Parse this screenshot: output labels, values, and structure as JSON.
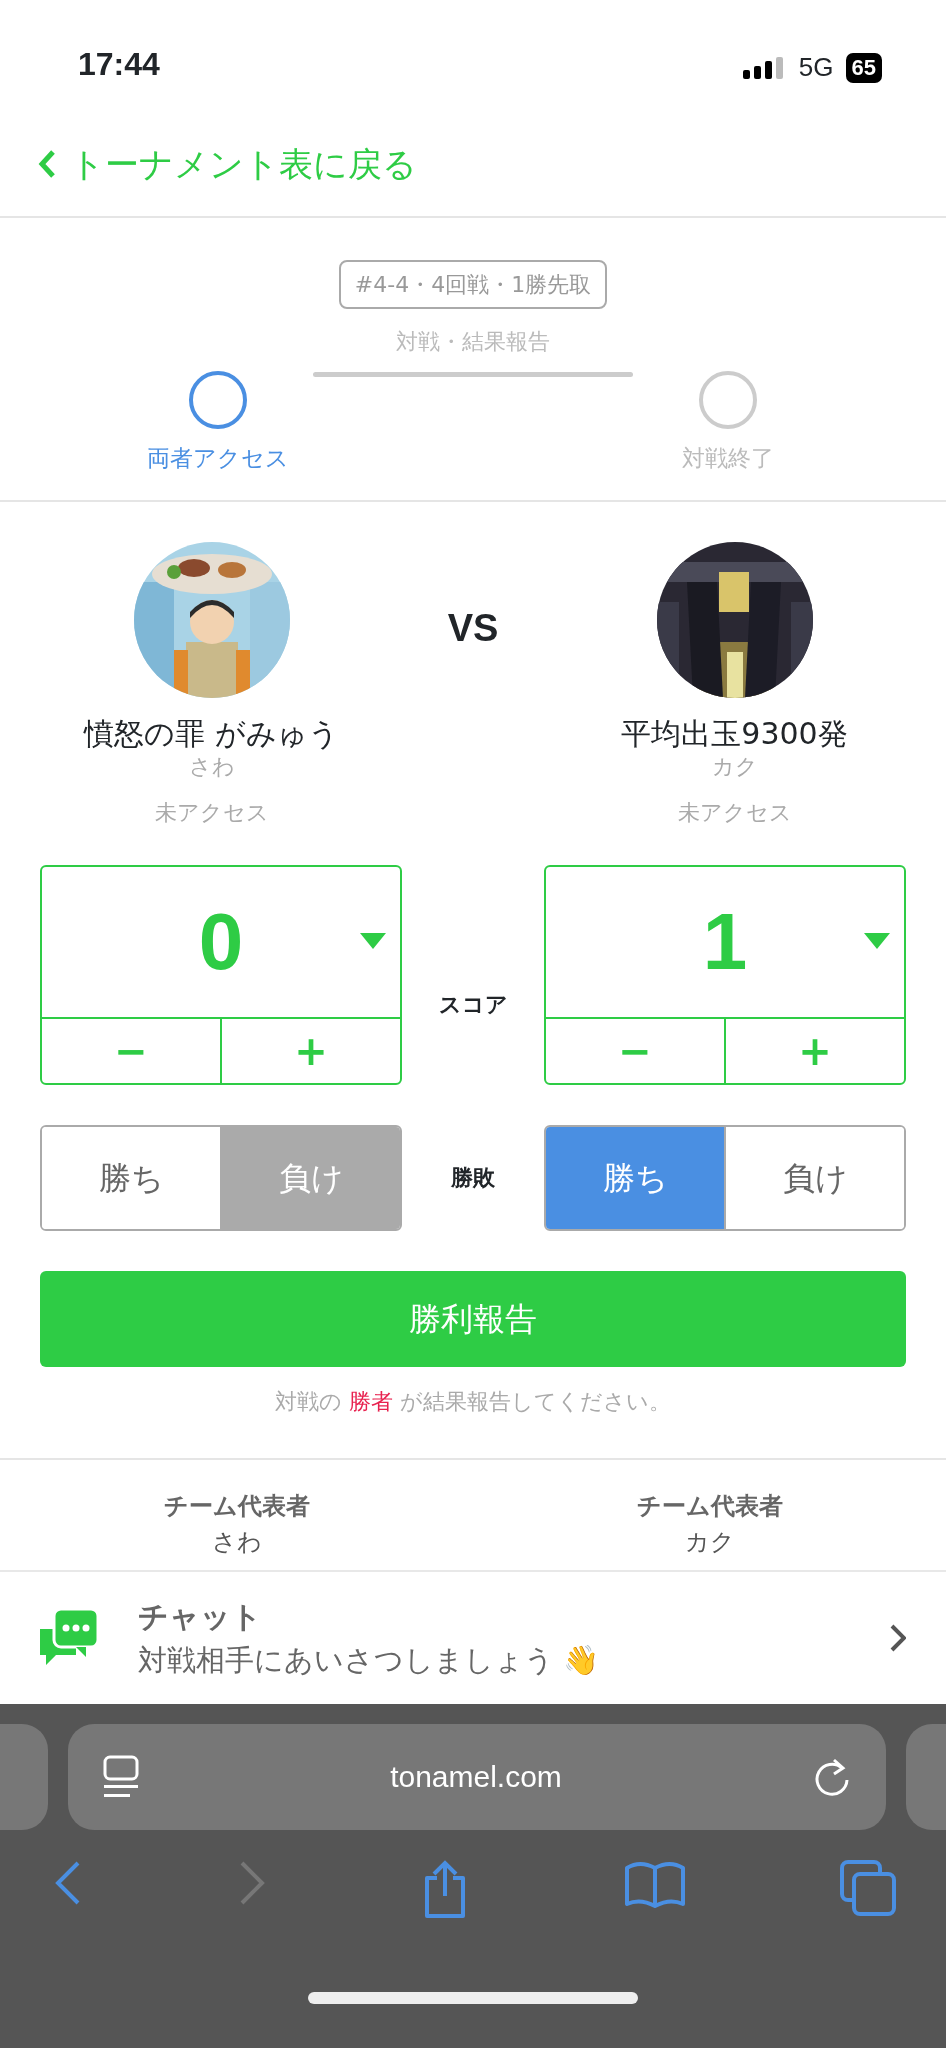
{
  "status_bar": {
    "time": "17:44",
    "network": "5G",
    "battery": "65"
  },
  "back_link": {
    "label": "トーナメント表に戻る"
  },
  "match_badge": "#4-4・4回戦・1勝先取",
  "progress": {
    "connector_label": "対戦・結果報告",
    "steps": [
      {
        "label": "両者アクセス",
        "selected": true
      },
      {
        "label": "対戦終了",
        "selected": false
      }
    ]
  },
  "versus_label": "VS",
  "players": [
    {
      "name": "憤怒の罪 がみゅう",
      "sub_name": "さわ",
      "access": "未アクセス",
      "score": "0",
      "decrement": "−",
      "increment": "+",
      "result_options": [
        {
          "kind": "win",
          "label": "勝ち",
          "selected": false
        },
        {
          "kind": "lose",
          "label": "負け",
          "selected": true
        }
      ]
    },
    {
      "name": "平均出玉9300発",
      "sub_name": "カク",
      "access": "未アクセス",
      "score": "1",
      "decrement": "−",
      "increment": "+",
      "result_options": [
        {
          "kind": "win",
          "label": "勝ち",
          "selected": true
        },
        {
          "kind": "lose",
          "label": "負け",
          "selected": false
        }
      ]
    }
  ],
  "score_label": "スコア",
  "result_label": "勝敗",
  "report_button": "勝利報告",
  "note": {
    "before": "対戦の",
    "highlight": "勝者",
    "after": "が結果報告してください。"
  },
  "team_representatives": [
    {
      "heading": "チーム代表者",
      "name": "さわ"
    },
    {
      "heading": "チーム代表者",
      "name": "カク"
    }
  ],
  "chat": {
    "title": "チャット",
    "message": "対戦相手にあいさつしましょう 👋"
  },
  "browser": {
    "url": "tonamel.com"
  }
}
